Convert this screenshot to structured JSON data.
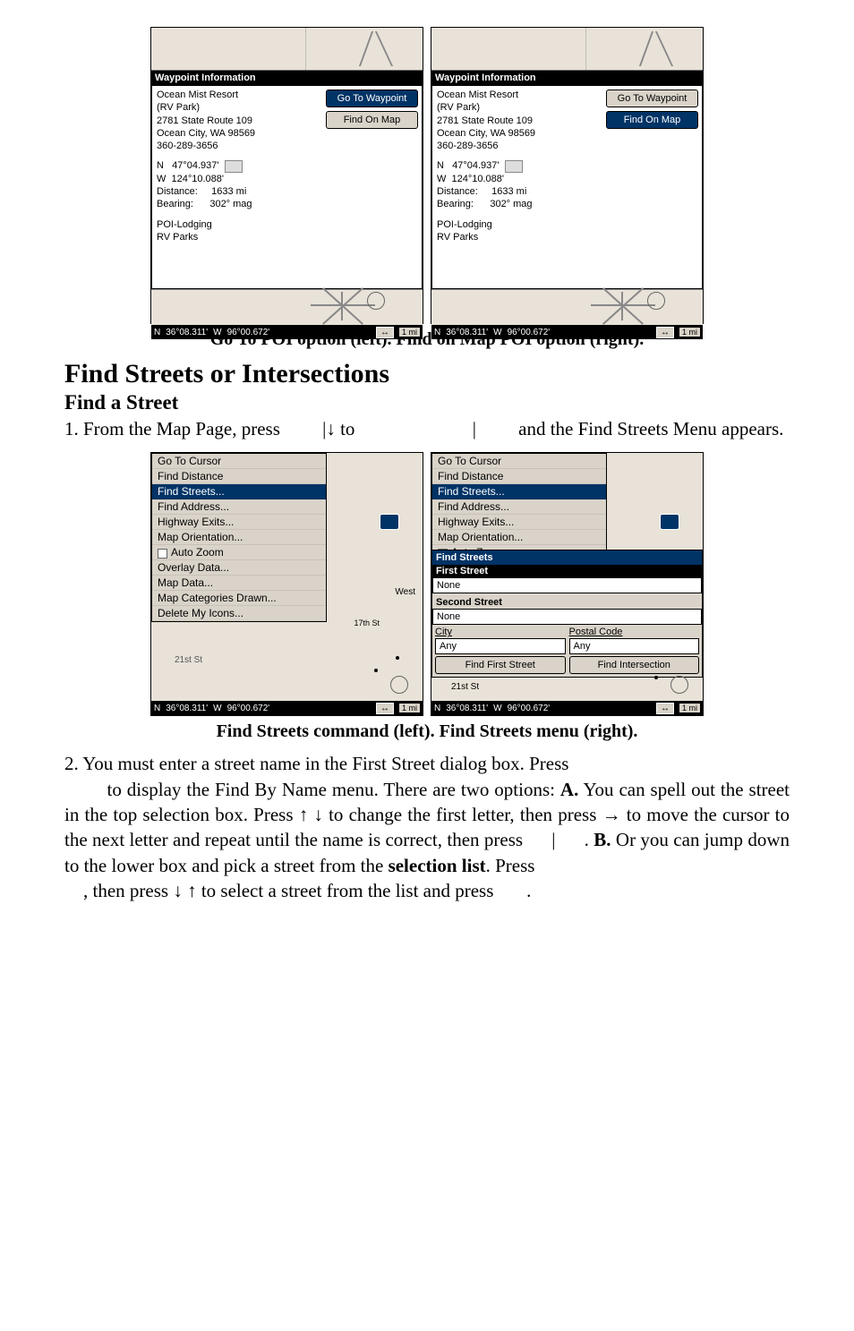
{
  "wp_header": "Waypoint Information",
  "poi": {
    "name": "Ocean Mist Resort",
    "sub": "(RV Park)",
    "addr1": "2781 State Route 109",
    "addr2": "Ocean City, WA 98569",
    "phone": "360-289-3656",
    "lat_label": "N",
    "lat": "47°04.937'",
    "lon_label": "W",
    "lon": "124°10.088'",
    "dist_label": "Distance:",
    "dist": "1633 mi",
    "bear_label": "Bearing:",
    "bear": "302° mag",
    "cat1": "POI-Lodging",
    "cat2": "RV Parks"
  },
  "btn_goto": "Go To Waypoint",
  "btn_findmap": "Find On Map",
  "status": {
    "n": "N",
    "lat": "36°08.311'",
    "w": "W",
    "lon": "96°00.672'",
    "arrow": "↔",
    "scale": "1 mi"
  },
  "caption1": "Go To POI option (left). Find on Map POI option (right).",
  "caption2": "Find Streets command (left). Find Streets menu (right).",
  "h1": "Find Streets or Intersections",
  "h2": "Find a Street",
  "p1a": "1. From the Map Page, press ",
  "p1b": "|↓ to ",
  "p1c": "|",
  "p1d": " and the Find Streets Menu appears.",
  "menu": {
    "items": [
      "Go To Cursor",
      "Find Distance",
      "Find Streets...",
      "Find Address...",
      "Highway Exits...",
      "Map Orientation...",
      "Auto Zoom",
      "Overlay Data...",
      "Map Data...",
      "Map Categories Drawn...",
      "Delete My Icons..."
    ],
    "items2": [
      "Go To Cursor",
      "Find Distance",
      "Find Streets...",
      "Find Address...",
      "Highway Exits...",
      "Map Orientation...",
      "Auto Zoom"
    ],
    "street_label_1": "21st St",
    "street_label_2": "17th St",
    "west": "West"
  },
  "fs": {
    "title": "Find Streets",
    "first": "First Street",
    "none": "None",
    "second": "Second Street",
    "city": "City",
    "postal": "Postal Code",
    "any": "Any",
    "btn1": "Find First Street",
    "btn2": "Find Intersection"
  },
  "p2": {
    "t1": "2. You must enter a street name in the First Street dialog box. Press ",
    "t2": " to display the Find By Name menu. There are two options: ",
    "b1": "A.",
    "t3": " You can spell out the street in the top selection box. Press ↑ ↓ to change the first letter, then press → to move the cursor to the next letter and repeat until the name is correct, then press ",
    "bar1": "|",
    "t4": " . ",
    "b2": "B.",
    "t5": " Or you can jump down to the lower box and pick a street from the ",
    "b3": "selection list",
    "t6": ". Press ",
    "t7": ", then press ↓ ↑ to select a street from the list and press ",
    "t8": "."
  }
}
